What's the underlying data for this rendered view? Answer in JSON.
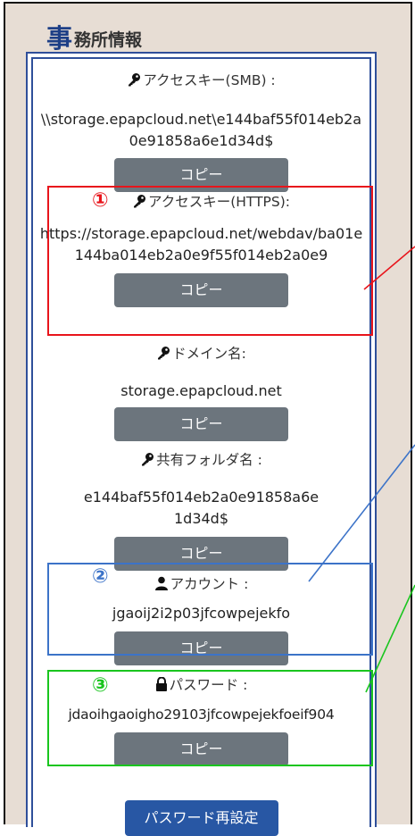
{
  "header": {
    "title_first_char": "事",
    "title_rest": "務所情報"
  },
  "items": [
    {
      "label": "アクセスキー(SMB) :",
      "value": "\\\\storage.epapcloud.net\\e144baf55f014eb2a0e91858a6e1d34d$",
      "copy": "コピー"
    },
    {
      "label": "アクセスキー(HTTPS):",
      "value": "https://storage.epapcloud.net/webdav/ba01e144ba014eb2a0e9f55f014eb2a0e9",
      "copy": "コピー"
    },
    {
      "label": "ドメイン名:",
      "value": "storage.epapcloud.net",
      "copy": "コピー"
    },
    {
      "label": "共有フォルダ名 :",
      "value": "e144baf55f014eb2a0e91858a6e1d34d$",
      "copy": "コピー"
    },
    {
      "label": "アカウント :",
      "value": "jgaoij2i2p03jfcowpejekfo",
      "copy": "コピー"
    },
    {
      "label": "パスワード :",
      "value": "jdaoihgaoigho29103jfcowpejekfoeif904",
      "copy": "コピー"
    }
  ],
  "reset_password_label": "パスワード再設定",
  "annotations": [
    {
      "number": "①",
      "color": "#e8141b"
    },
    {
      "number": "②",
      "color": "#3c73c8"
    },
    {
      "number": "③",
      "color": "#19c51e"
    }
  ],
  "icons": {
    "key": "key-icon",
    "person": "person-icon",
    "lock": "lock-icon"
  }
}
